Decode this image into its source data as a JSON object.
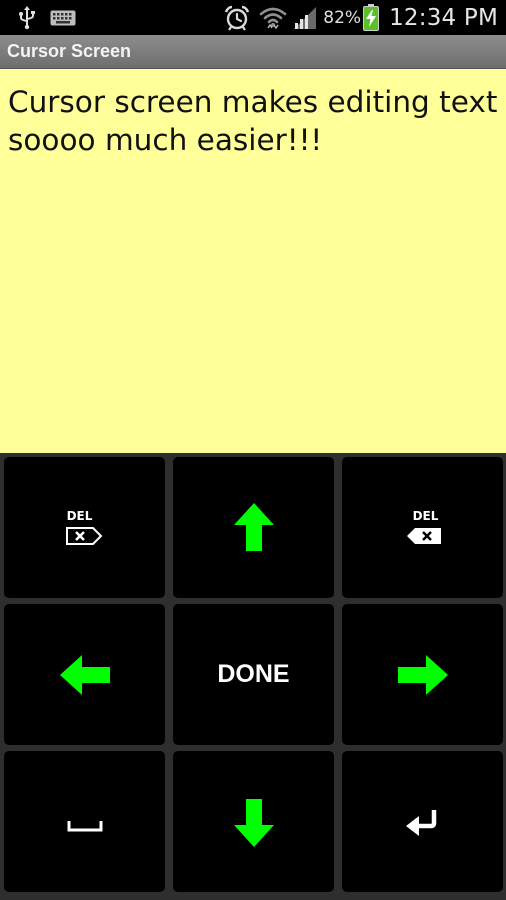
{
  "status_bar": {
    "battery_percent": "82%",
    "time": "12:34 PM",
    "icons": [
      "usb-icon",
      "keyboard-icon",
      "alarm-icon",
      "wifi-icon",
      "signal-icon",
      "battery-charging-icon"
    ]
  },
  "title_bar": {
    "title": "Cursor Screen"
  },
  "editor": {
    "text": "Cursor screen makes editing text soooo much easier!!!",
    "background": "#ffff99"
  },
  "keypad": {
    "arrow_color": "#00ff00",
    "delete_left_label": "DEL",
    "delete_right_label": "DEL",
    "done_label": "DONE",
    "icons": [
      "delete-forward-icon",
      "arrow-up-icon",
      "backspace-icon",
      "arrow-left-icon",
      "arrow-right-icon",
      "space-icon",
      "arrow-down-icon",
      "enter-icon"
    ]
  }
}
